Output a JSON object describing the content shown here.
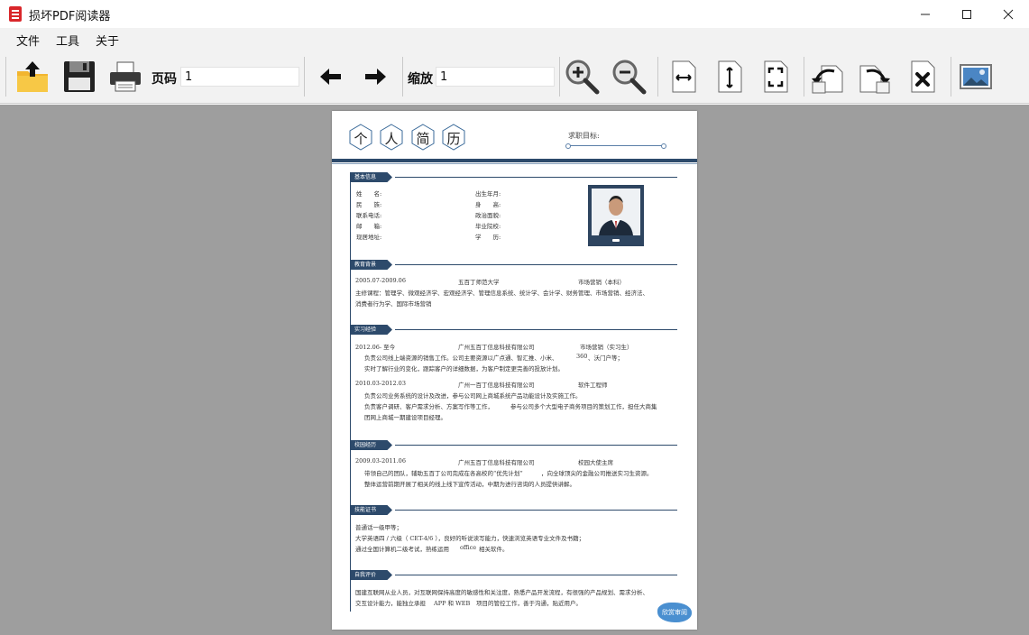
{
  "window": {
    "title": "损坏PDF阅读器",
    "minimize": "—",
    "maximize": "☐",
    "close": "✕"
  },
  "menu": {
    "items": [
      "文件",
      "工具",
      "关于"
    ]
  },
  "toolbar": {
    "page_label": "页码",
    "page_value": "1",
    "zoom_label": "缩放",
    "zoom_value": "1"
  },
  "resume": {
    "title_chars": [
      "个",
      "人",
      "简",
      "历"
    ],
    "objective_label": "求职目标:",
    "sections": {
      "basic": "基本信息",
      "education": "教育背景",
      "internship": "实习经验",
      "campus": "校园经历",
      "skills": "技能证书",
      "self": "自我评价"
    },
    "basic_fields_left": [
      "姓　　名:",
      "民　　族:",
      "联系电话:",
      "邮　　箱:",
      "现居地址:"
    ],
    "basic_fields_right": [
      "出生年月:",
      "身　　高:",
      "政治面貌:",
      "毕业院校:",
      "学　　历:"
    ],
    "education": {
      "date": "2005.07-2009.06",
      "school": "五百丁师范大学",
      "major": "市场营销（本科）",
      "line1": "主修课程：管理学、微观经济学、宏观经济学、管理信息系统、统计学、会计学、财务管理、市场营销、经济法、",
      "line2": "消费者行为学、国际市场营销"
    },
    "intern1": {
      "date": "2012.06- 至今",
      "company": "广州五百丁信息科技有限公司",
      "role": "市场营销（实习生）",
      "line1": "负责公司线上端资源的销售工作。公司主要资源以广点通、智汇推、小米、",
      "line1b": "360",
      "line1c": "、沃门户等；",
      "line2": "实时了解行业的变化，跟踪客户的详细数据，为客户制定更完善的投放计划。"
    },
    "intern2": {
      "date": "2010.03-2012.03",
      "company": "广州一百丁信息科技有限公司",
      "role": "软件工程师",
      "line1": "负责公司业务系统的设计及改进，参与公司网上商城系统产品功能设计及实施工作。",
      "line2a": "负责客户调研、客户需求分析、方案写作等工作，",
      "line2b": "参与公司多个大型电子商务项目的策划工作，担任大商集",
      "line3": "团网上商城一期建设项目经理。"
    },
    "campus": {
      "date": "2009.03-2011.06",
      "company": "广州五百丁信息科技有限公司",
      "role": "校园大使主席",
      "line1a": "带领自己的团队，辅助五百丁公司完成在各高校的“优先计划”",
      "line1b": "，向全球顶尖的金融公司推送实习生资源。",
      "line2": "整体运营前期开展了相关的线上线下宣传活动，中期为进行咨询的人员提供讲解。"
    },
    "skills": {
      "line1": "普通话一级甲等；",
      "line2": "大学英语四 / 六级（ CET-4/6 ），良好的听说读写能力，快速浏览英语专业文件及书籍；",
      "line3a": "通过全国计算机二级考试，熟练运用",
      "line3b": "office",
      "line3c": "相关软件。"
    },
    "self": {
      "line1": "国建互联网从业人员，对互联网保持高度的敏感性和关注度，熟悉产品开发流程，有很强的产品规划、需求分析、",
      "line2a": "交互设计能力，能独立承担",
      "line2b": "APP 和 WEB",
      "line2c": "项目的管控工作，善于沟通，贴近用户。"
    },
    "stamp": "欣赏审阅"
  }
}
